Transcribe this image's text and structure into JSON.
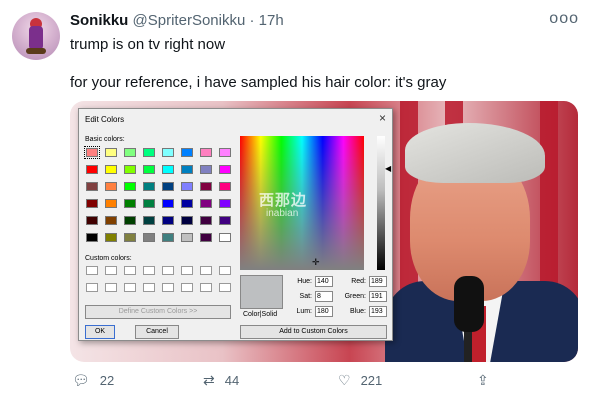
{
  "tweet": {
    "display_name": "Sonikku",
    "handle": "@SpriterSonikku",
    "separator": "·",
    "time": "17h",
    "more": "ooo",
    "line1": "trump is on tv right now",
    "line2": "for your reference, i have sampled his hair color: it's gray"
  },
  "dialog": {
    "title": "Edit Colors",
    "close": "×",
    "basic_colors_label": "Basic colors:",
    "custom_colors_label": "Custom colors:",
    "define_button": "Define Custom Colors >>",
    "ok_button": "OK",
    "cancel_button": "Cancel",
    "color_solid_label": "Color|Solid",
    "add_button": "Add to Custom Colors",
    "watermark_cn": "西那边",
    "watermark_en": "inabian",
    "fields": {
      "hue_label": "Hue:",
      "hue": "140",
      "sat_label": "Sat:",
      "sat": "8",
      "lum_label": "Lum:",
      "lum": "180",
      "red_label": "Red:",
      "red": "189",
      "green_label": "Green:",
      "green": "191",
      "blue_label": "Blue:",
      "blue": "193"
    },
    "basic_colors": [
      [
        "#ff8080",
        "#ffff80",
        "#80ff80",
        "#00ff80",
        "#80ffff",
        "#0080ff",
        "#ff80c0",
        "#ff80ff"
      ],
      [
        "#ff0000",
        "#ffff00",
        "#80ff00",
        "#00ff40",
        "#00ffff",
        "#0080c0",
        "#8080c0",
        "#ff00ff"
      ],
      [
        "#804040",
        "#ff8040",
        "#00ff00",
        "#008080",
        "#004080",
        "#8080ff",
        "#800040",
        "#ff0080"
      ],
      [
        "#800000",
        "#ff8000",
        "#008000",
        "#008040",
        "#0000ff",
        "#0000a0",
        "#800080",
        "#8000ff"
      ],
      [
        "#400000",
        "#804000",
        "#004000",
        "#004040",
        "#000080",
        "#000040",
        "#400040",
        "#400080"
      ],
      [
        "#000000",
        "#808000",
        "#808040",
        "#808080",
        "#408080",
        "#c0c0c0",
        "#400040",
        "#ffffff"
      ]
    ]
  },
  "actions": {
    "reply_icon": "reply-icon",
    "reply_count": "22",
    "retweet_icon": "retweet-icon",
    "retweet_count": "44",
    "like_icon": "heart-icon",
    "like_count": "221",
    "share_icon": "share-icon"
  }
}
